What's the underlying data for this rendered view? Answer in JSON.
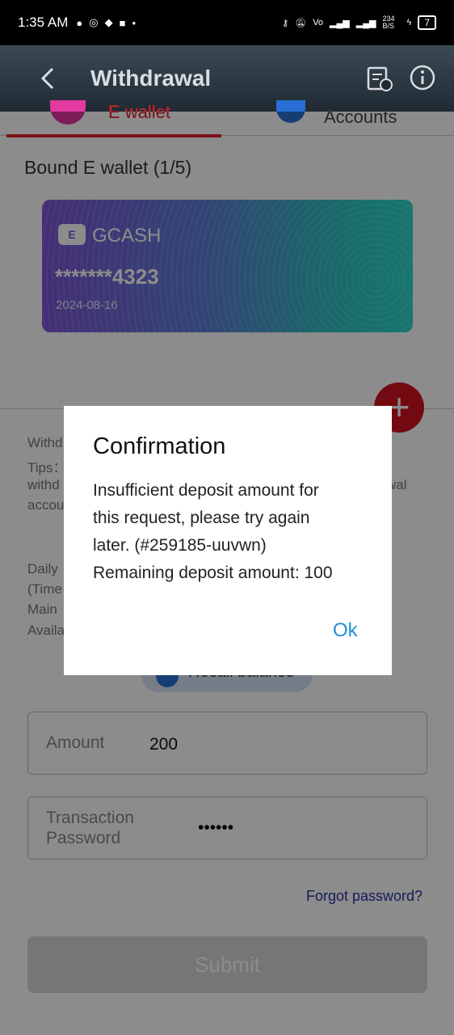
{
  "status_bar": {
    "time": "1:35 AM",
    "speed": "234\nB/S",
    "battery": "7"
  },
  "header": {
    "title": "Withdrawal"
  },
  "tabs": [
    {
      "label": "E wallet"
    },
    {
      "label": "Accounts"
    }
  ],
  "bound_title": "Bound E wallet (1/5)",
  "card": {
    "logo": "E",
    "provider": "GCASH",
    "number": "*******4323",
    "date": "2024-08-16"
  },
  "background_fragments": {
    "left": [
      "Withd",
      "Tips：",
      "withd",
      "accou",
      "Daily",
      "(Time",
      "Main",
      "Availa"
    ],
    "right": "wal"
  },
  "recall": {
    "label": "Recall balance"
  },
  "form": {
    "amount_label": "Amount",
    "amount_value": "200",
    "password_label_1": "Transaction",
    "password_label_2": "Password",
    "password_value": "••••••",
    "forgot": "Forgot password?",
    "submit": "Submit"
  },
  "dialog": {
    "title": "Confirmation",
    "line1": "Insufficient deposit amount for",
    "line2": "this request, please try again",
    "line3": "later. (#259185-uuvwn)",
    "line4": "Remaining deposit amount: 100",
    "ok": "Ok"
  },
  "colors": {
    "accent_red": "#e0202a",
    "ok_blue": "#1f8fd6",
    "card_start": "#7b54d6",
    "card_end": "#2ad8c8"
  }
}
